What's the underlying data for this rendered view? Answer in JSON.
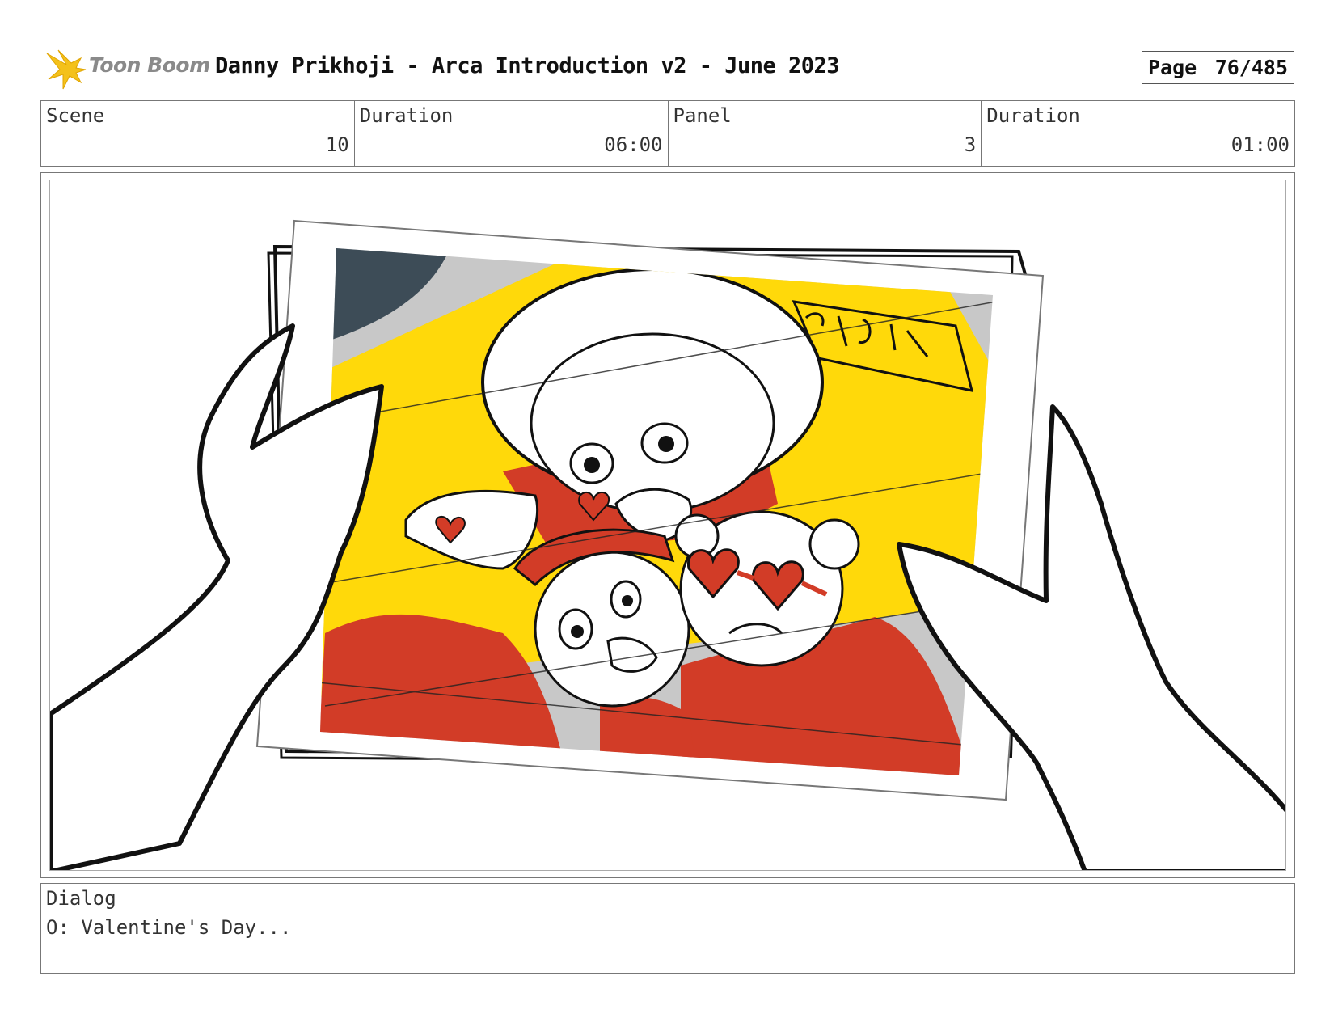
{
  "header": {
    "brand": "Toon Boom",
    "title": "Danny Prikhoji - Arca Introduction v2 - June 2023",
    "page_label": "Page",
    "page_number": "76/485"
  },
  "info": {
    "scene_label": "Scene",
    "scene_value": "10",
    "scene_duration_label": "Duration",
    "scene_duration_value": "06:00",
    "panel_label": "Panel",
    "panel_value": "3",
    "panel_duration_label": "Duration",
    "panel_duration_value": "01:00"
  },
  "panel": {
    "sign_text": "SCHOOL BUS",
    "colors": {
      "yellow": "#ffd90a",
      "red": "#d23c27",
      "slate": "#3d4c57",
      "gray": "#c8c8c8"
    }
  },
  "dialog": {
    "label": "Dialog",
    "text": "O: Valentine's Day..."
  }
}
